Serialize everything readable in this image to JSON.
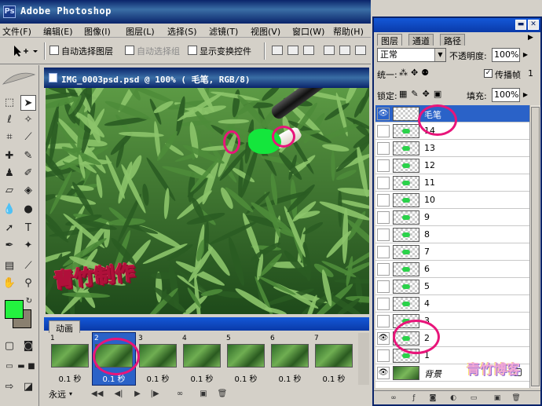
{
  "app": {
    "title": "Adobe Photoshop",
    "logo": "Ps"
  },
  "menu": [
    "文件(F)",
    "编辑(E)",
    "图像(I)",
    "图层(L)",
    "选择(S)",
    "滤镜(T)",
    "视图(V)",
    "窗口(W)",
    "帮助(H)"
  ],
  "options": {
    "tool_icon": "move-tool-icon",
    "auto_select_layer": "自动选择图层",
    "auto_select_group": "自动选择组",
    "show_transform": "显示变换控件"
  },
  "document": {
    "title": "IMG_0003psd.psd @ 100% ( 毛笔, RGB/8)",
    "watermark": "青竹制作"
  },
  "colors": {
    "foreground": "#23f23f",
    "background": "#8a8070",
    "brush_paint": "#14e63c",
    "highlight_ring": "#e8157a"
  },
  "animation": {
    "tab": "动画",
    "loop": "永远",
    "frames": [
      {
        "n": "1",
        "delay": "0.1 秒"
      },
      {
        "n": "2",
        "delay": "0.1 秒",
        "selected": true
      },
      {
        "n": "3",
        "delay": "0.1 秒"
      },
      {
        "n": "4",
        "delay": "0.1 秒"
      },
      {
        "n": "5",
        "delay": "0.1 秒"
      },
      {
        "n": "6",
        "delay": "0.1 秒"
      },
      {
        "n": "7",
        "delay": "0.1 秒"
      }
    ]
  },
  "layers": {
    "tabs": [
      "图层",
      "通道",
      "路径"
    ],
    "blend_mode": "正常",
    "opacity_label": "不透明度:",
    "opacity": "100%",
    "unify_label": "统一:",
    "propagate_label": "传播帧",
    "propagate_value": "1",
    "lock_label": "锁定:",
    "fill_label": "填充:",
    "fill": "100%",
    "rows": [
      {
        "name": "毛笔",
        "visible": true,
        "selected": true
      },
      {
        "name": "14"
      },
      {
        "name": "13"
      },
      {
        "name": "12"
      },
      {
        "name": "11"
      },
      {
        "name": "10"
      },
      {
        "name": "9"
      },
      {
        "name": "8"
      },
      {
        "name": "7"
      },
      {
        "name": "6"
      },
      {
        "name": "5"
      },
      {
        "name": "4"
      },
      {
        "name": "3"
      },
      {
        "name": "2",
        "visible": true
      },
      {
        "name": "1"
      },
      {
        "name": "背景",
        "visible": true,
        "background": true
      }
    ]
  },
  "blog_watermark": "青竹博客"
}
